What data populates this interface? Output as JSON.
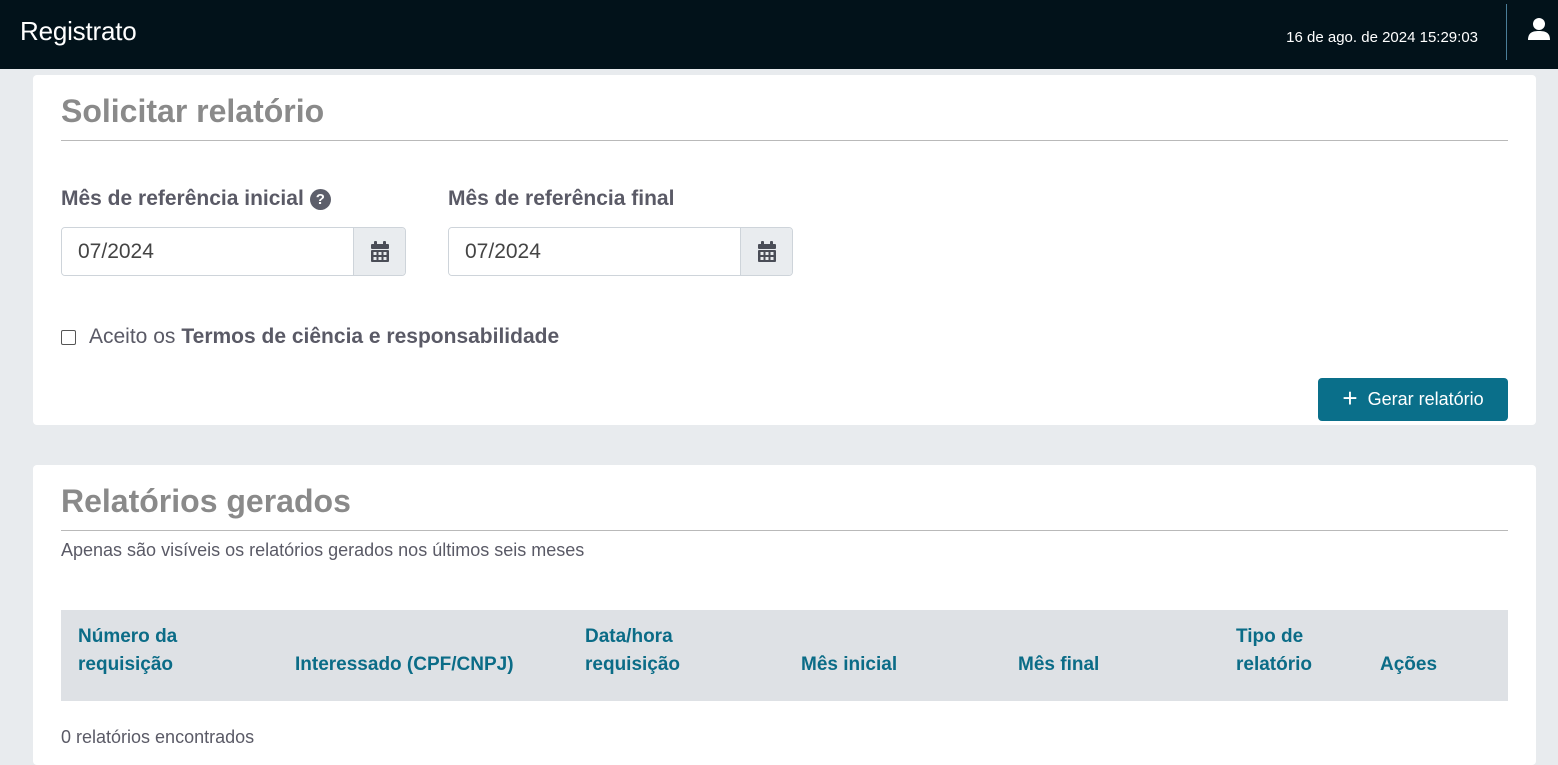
{
  "header": {
    "brand": "Registrato",
    "datetime": "16 de ago. de 2024 15:29:03",
    "user_icon": "user-icon"
  },
  "request_form": {
    "title": "Solicitar relatório",
    "start_month": {
      "label": "Mês de referência inicial",
      "help_icon": "question-circle-icon",
      "value": "07/2024",
      "calendar_icon": "calendar-icon"
    },
    "end_month": {
      "label": "Mês de referência final",
      "value": "07/2024",
      "calendar_icon": "calendar-icon"
    },
    "terms": {
      "prefix": "Aceito os",
      "link": "Termos de ciência e responsabilidade",
      "checked": false
    },
    "generate_button": {
      "icon": "plus-icon",
      "label": "Gerar relatório"
    }
  },
  "reports": {
    "title": "Relatórios gerados",
    "subtitle": "Apenas são visíveis os relatórios gerados nos últimos seis meses",
    "columns": [
      {
        "line1": "Número da",
        "line2": "requisição"
      },
      {
        "line1": "",
        "line2": "Interessado (CPF/CNPJ)"
      },
      {
        "line1": "Data/hora",
        "line2": "requisição"
      },
      {
        "line1": "",
        "line2": "Mês inicial"
      },
      {
        "line1": "",
        "line2": "Mês final"
      },
      {
        "line1": "Tipo de",
        "line2": "relatório"
      },
      {
        "line1": "",
        "line2": "Ações"
      }
    ],
    "count_text": "0 relatórios encontrados"
  },
  "colors": {
    "header_bg": "#02121a",
    "accent": "#0a6f8a",
    "table_header_bg": "#dee1e5",
    "page_bg": "#e8ebee"
  }
}
